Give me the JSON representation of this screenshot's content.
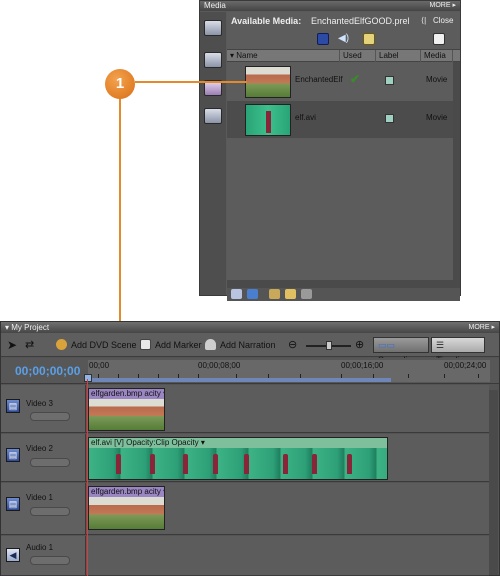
{
  "media": {
    "title": "Media",
    "more": "MORE ▸",
    "header_label": "Available Media:",
    "project_file": "EnchantedElfGOOD.prel",
    "close": "Close",
    "columns": {
      "name": "Name",
      "used": "Used",
      "label": "Label",
      "media": "Media"
    },
    "rows": [
      {
        "name": "EnchantedElf",
        "used": "✔",
        "type": "Movie"
      },
      {
        "name": "elf.avi",
        "used": "",
        "type": "Movie"
      }
    ],
    "colors": {
      "panel": "#5a5a5a",
      "selected_row": "#4c4c4c",
      "label_swatch": "#9fd1c3"
    }
  },
  "callout": {
    "number": "1",
    "color": "#e48a2c"
  },
  "project": {
    "title": "My Project",
    "more": "MORE ▸",
    "toolbar": {
      "add_dvd_scene": "Add DVD Scene",
      "add_marker": "Add Marker",
      "add_narration": "Add Narration",
      "sceneline": "Sceneline",
      "timeline": "Timeline"
    },
    "timecode": "00;00;00;00",
    "ruler": [
      "00;00",
      "00;00;08;00",
      "00;00;16;00",
      "00;00;24;00"
    ],
    "tracks": [
      {
        "name": "Video 3",
        "clip": "elfgarden.bmp",
        "clip_suffix": "acity ▾"
      },
      {
        "name": "Video 2",
        "clip": "elf.avi [V]",
        "clip_suffix": "Opacity:Clip Opacity ▾"
      },
      {
        "name": "Video 1",
        "clip": "elfgarden.bmp",
        "clip_suffix": "acity ▾"
      },
      {
        "name": "Audio 1",
        "clip": "",
        "clip_suffix": ""
      }
    ],
    "colors": {
      "timecode": "#5aa0e8",
      "playhead": "#e03a3a",
      "workarea": "#6f86b8"
    }
  }
}
